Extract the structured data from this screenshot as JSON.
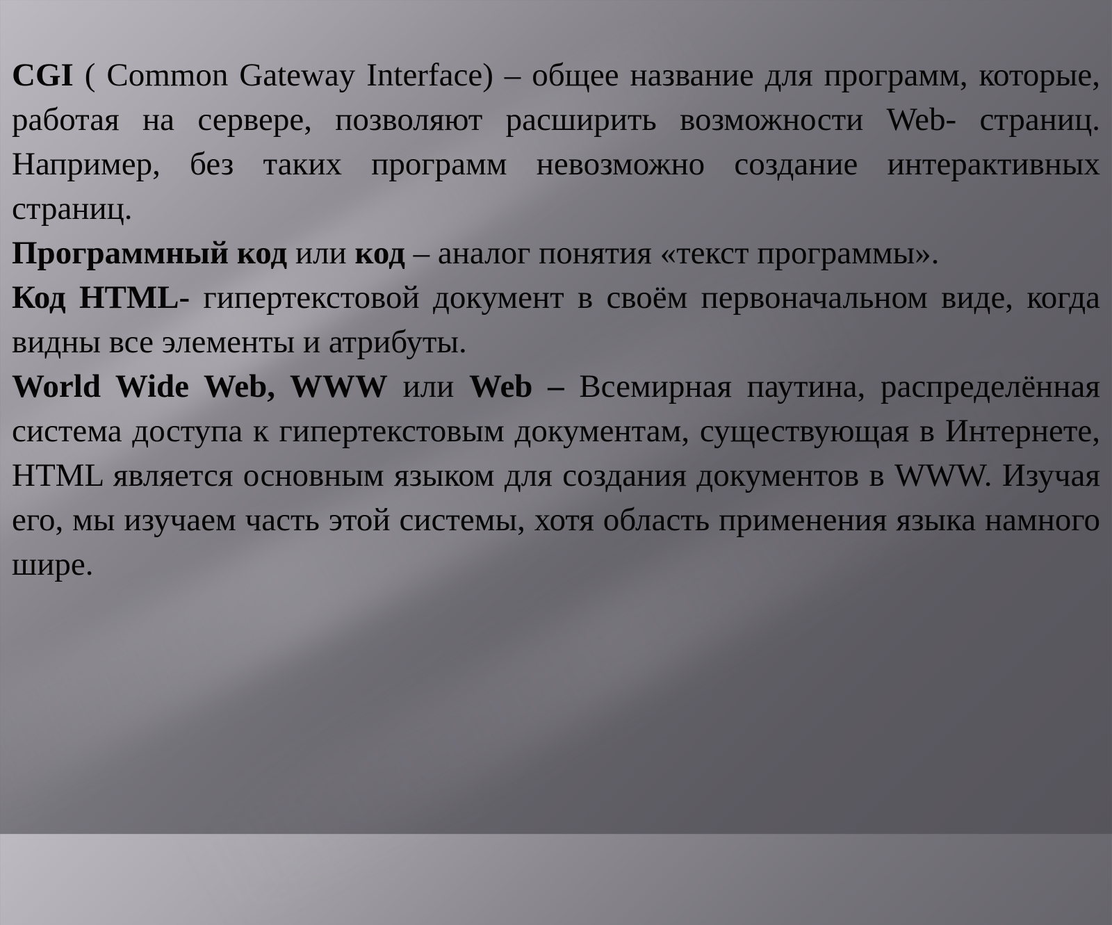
{
  "slide": {
    "paragraphs": [
      {
        "segments": [
          {
            "text": "CGI",
            "bold": true
          },
          {
            "text": " ( Common Gateway Interface) – общее название для программ, которые, работая на сервере, позволяют расширить возможности Web- страниц. Например, без таких программ невозможно создание интерактивных страниц.",
            "bold": false
          }
        ]
      },
      {
        "segments": [
          {
            "text": "Программный код",
            "bold": true
          },
          {
            "text": " или ",
            "bold": false
          },
          {
            "text": "код",
            "bold": true
          },
          {
            "text": " – аналог понятия «текст программы».",
            "bold": false
          }
        ]
      },
      {
        "segments": [
          {
            "text": "Код HTML-",
            "bold": true
          },
          {
            "text": " гипертекстовой документ в своём первоначальном виде, когда видны все элементы и атрибуты.",
            "bold": false
          }
        ]
      },
      {
        "segments": [
          {
            "text": "World Wide Web, WWW",
            "bold": true
          },
          {
            "text": " или ",
            "bold": false
          },
          {
            "text": "Web –",
            "bold": true
          },
          {
            "text": " Всемирная паутина, распределённая система доступа к гипертекстовым документам, существующая в Интернете, HTML является основным языком для создания документов в WWW. Изучая его, мы изучаем часть этой системы, хотя область применения языка намного шире.",
            "bold": false
          }
        ]
      }
    ]
  }
}
